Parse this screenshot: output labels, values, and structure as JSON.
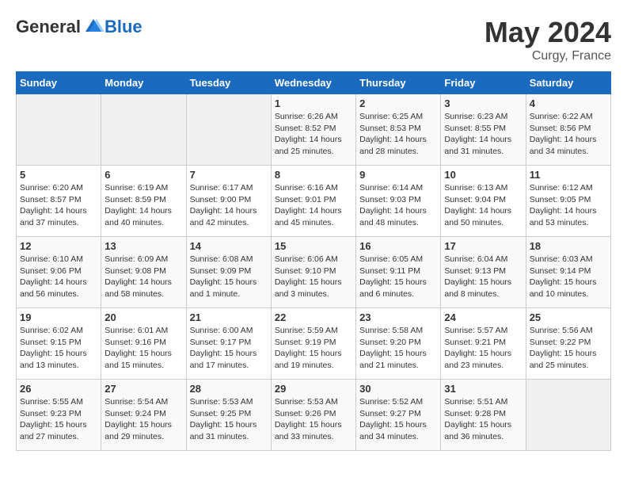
{
  "header": {
    "logo_general": "General",
    "logo_blue": "Blue",
    "month": "May 2024",
    "location": "Curgy, France"
  },
  "days_of_week": [
    "Sunday",
    "Monday",
    "Tuesday",
    "Wednesday",
    "Thursday",
    "Friday",
    "Saturday"
  ],
  "weeks": [
    [
      {
        "day": "",
        "info": ""
      },
      {
        "day": "",
        "info": ""
      },
      {
        "day": "",
        "info": ""
      },
      {
        "day": "1",
        "info": "Sunrise: 6:26 AM\nSunset: 8:52 PM\nDaylight: 14 hours and 25 minutes."
      },
      {
        "day": "2",
        "info": "Sunrise: 6:25 AM\nSunset: 8:53 PM\nDaylight: 14 hours and 28 minutes."
      },
      {
        "day": "3",
        "info": "Sunrise: 6:23 AM\nSunset: 8:55 PM\nDaylight: 14 hours and 31 minutes."
      },
      {
        "day": "4",
        "info": "Sunrise: 6:22 AM\nSunset: 8:56 PM\nDaylight: 14 hours and 34 minutes."
      }
    ],
    [
      {
        "day": "5",
        "info": "Sunrise: 6:20 AM\nSunset: 8:57 PM\nDaylight: 14 hours and 37 minutes."
      },
      {
        "day": "6",
        "info": "Sunrise: 6:19 AM\nSunset: 8:59 PM\nDaylight: 14 hours and 40 minutes."
      },
      {
        "day": "7",
        "info": "Sunrise: 6:17 AM\nSunset: 9:00 PM\nDaylight: 14 hours and 42 minutes."
      },
      {
        "day": "8",
        "info": "Sunrise: 6:16 AM\nSunset: 9:01 PM\nDaylight: 14 hours and 45 minutes."
      },
      {
        "day": "9",
        "info": "Sunrise: 6:14 AM\nSunset: 9:03 PM\nDaylight: 14 hours and 48 minutes."
      },
      {
        "day": "10",
        "info": "Sunrise: 6:13 AM\nSunset: 9:04 PM\nDaylight: 14 hours and 50 minutes."
      },
      {
        "day": "11",
        "info": "Sunrise: 6:12 AM\nSunset: 9:05 PM\nDaylight: 14 hours and 53 minutes."
      }
    ],
    [
      {
        "day": "12",
        "info": "Sunrise: 6:10 AM\nSunset: 9:06 PM\nDaylight: 14 hours and 56 minutes."
      },
      {
        "day": "13",
        "info": "Sunrise: 6:09 AM\nSunset: 9:08 PM\nDaylight: 14 hours and 58 minutes."
      },
      {
        "day": "14",
        "info": "Sunrise: 6:08 AM\nSunset: 9:09 PM\nDaylight: 15 hours and 1 minute."
      },
      {
        "day": "15",
        "info": "Sunrise: 6:06 AM\nSunset: 9:10 PM\nDaylight: 15 hours and 3 minutes."
      },
      {
        "day": "16",
        "info": "Sunrise: 6:05 AM\nSunset: 9:11 PM\nDaylight: 15 hours and 6 minutes."
      },
      {
        "day": "17",
        "info": "Sunrise: 6:04 AM\nSunset: 9:13 PM\nDaylight: 15 hours and 8 minutes."
      },
      {
        "day": "18",
        "info": "Sunrise: 6:03 AM\nSunset: 9:14 PM\nDaylight: 15 hours and 10 minutes."
      }
    ],
    [
      {
        "day": "19",
        "info": "Sunrise: 6:02 AM\nSunset: 9:15 PM\nDaylight: 15 hours and 13 minutes."
      },
      {
        "day": "20",
        "info": "Sunrise: 6:01 AM\nSunset: 9:16 PM\nDaylight: 15 hours and 15 minutes."
      },
      {
        "day": "21",
        "info": "Sunrise: 6:00 AM\nSunset: 9:17 PM\nDaylight: 15 hours and 17 minutes."
      },
      {
        "day": "22",
        "info": "Sunrise: 5:59 AM\nSunset: 9:19 PM\nDaylight: 15 hours and 19 minutes."
      },
      {
        "day": "23",
        "info": "Sunrise: 5:58 AM\nSunset: 9:20 PM\nDaylight: 15 hours and 21 minutes."
      },
      {
        "day": "24",
        "info": "Sunrise: 5:57 AM\nSunset: 9:21 PM\nDaylight: 15 hours and 23 minutes."
      },
      {
        "day": "25",
        "info": "Sunrise: 5:56 AM\nSunset: 9:22 PM\nDaylight: 15 hours and 25 minutes."
      }
    ],
    [
      {
        "day": "26",
        "info": "Sunrise: 5:55 AM\nSunset: 9:23 PM\nDaylight: 15 hours and 27 minutes."
      },
      {
        "day": "27",
        "info": "Sunrise: 5:54 AM\nSunset: 9:24 PM\nDaylight: 15 hours and 29 minutes."
      },
      {
        "day": "28",
        "info": "Sunrise: 5:53 AM\nSunset: 9:25 PM\nDaylight: 15 hours and 31 minutes."
      },
      {
        "day": "29",
        "info": "Sunrise: 5:53 AM\nSunset: 9:26 PM\nDaylight: 15 hours and 33 minutes."
      },
      {
        "day": "30",
        "info": "Sunrise: 5:52 AM\nSunset: 9:27 PM\nDaylight: 15 hours and 34 minutes."
      },
      {
        "day": "31",
        "info": "Sunrise: 5:51 AM\nSunset: 9:28 PM\nDaylight: 15 hours and 36 minutes."
      },
      {
        "day": "",
        "info": ""
      }
    ]
  ]
}
